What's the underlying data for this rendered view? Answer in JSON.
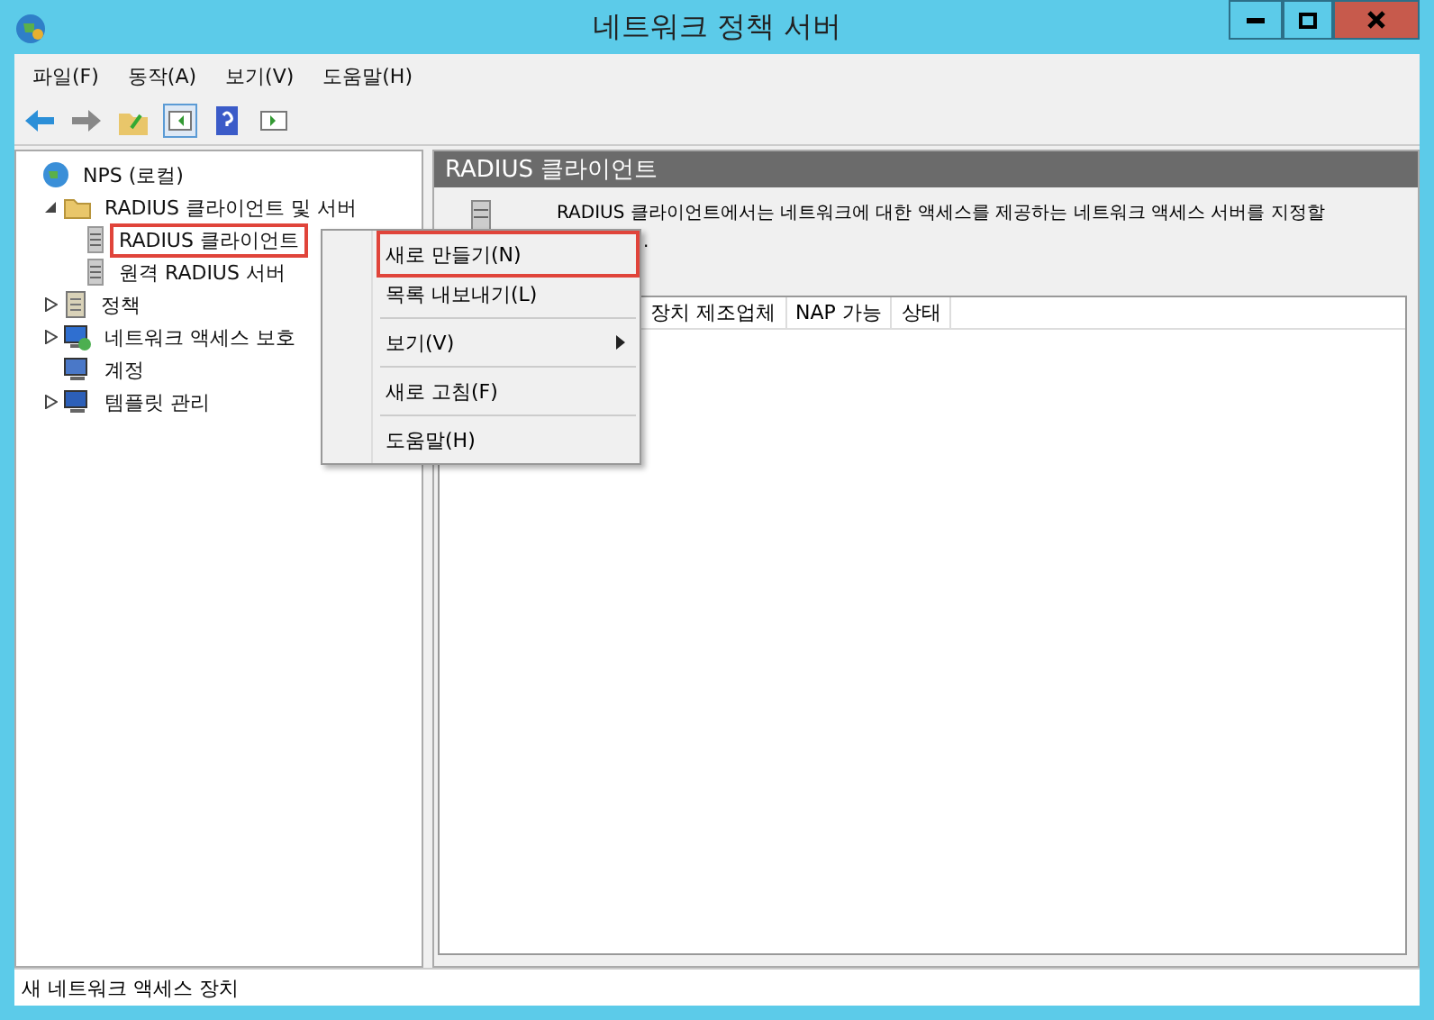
{
  "window": {
    "title": "네트워크 정책 서버"
  },
  "menu_bar": [
    "파일(F)",
    "동작(A)",
    "보기(V)",
    "도움말(H)"
  ],
  "tree": [
    {
      "label": "NPS (로컬)",
      "kind": "root",
      "highlighted": false,
      "children": [
        {
          "label": "RADIUS 클라이언트 및 서버",
          "kind": "folder",
          "expanded": true,
          "highlighted": false,
          "children": [
            {
              "label": "RADIUS 클라이언트",
              "kind": "server",
              "highlighted": true
            },
            {
              "label": "원격 RADIUS 서버",
              "kind": "server",
              "highlighted": false
            }
          ]
        },
        {
          "label": "정책",
          "kind": "policy",
          "expanded": false,
          "highlighted": false
        },
        {
          "label": "네트워크 액세스 보호",
          "kind": "network",
          "expanded": false,
          "highlighted": false
        },
        {
          "label": "계정",
          "kind": "account",
          "highlighted": false
        },
        {
          "label": "템플릿 관리",
          "kind": "template",
          "expanded": false,
          "highlighted": false
        }
      ]
    }
  ],
  "panel": {
    "title": "RADIUS 클라이언트",
    "description": "RADIUS 클라이언트에서는 네트워크에 대한 액세스를 제공하는 네트워크 액세스 서버를 지정할",
    "description_line_2": ".",
    "columns": [
      "장치 제조업체",
      "NAP 가능",
      "상태"
    ]
  },
  "context_menu": [
    {
      "label": "새로 만들기(N)",
      "kind": "item",
      "highlighted": true
    },
    {
      "label": "목록 내보내기(L)",
      "kind": "item",
      "highlighted": false
    },
    {
      "label": "보기(V)",
      "kind": "submenu",
      "highlighted": false
    },
    {
      "label": "새로 고침(F)",
      "kind": "item",
      "highlighted": false
    },
    {
      "label": "도움말(H)",
      "kind": "item",
      "highlighted": false
    }
  ],
  "status_bar": "새 네트워크 액세스 장치"
}
